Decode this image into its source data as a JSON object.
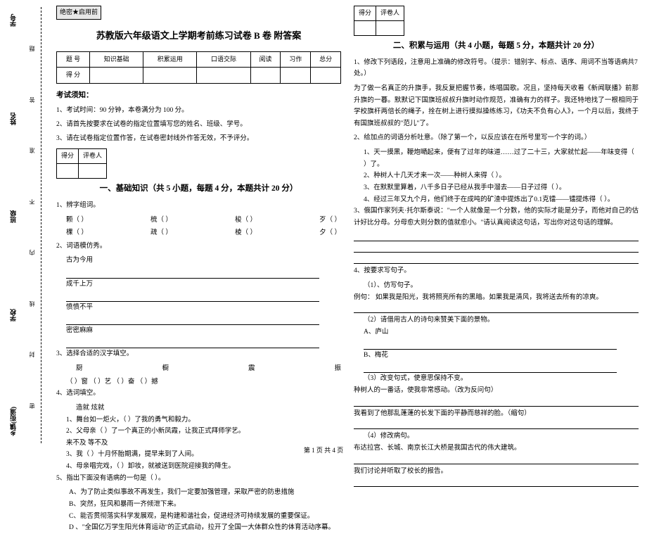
{
  "binding": {
    "labels": [
      "学号",
      "姓名",
      "班级",
      "学校",
      "乡镇(街道)"
    ],
    "marks": [
      "题",
      "答",
      "准",
      "不",
      "内",
      "线",
      "封",
      "密"
    ]
  },
  "header": {
    "secret": "绝密★启用前",
    "title": "苏教版六年级语文上学期考前练习试卷 B 卷 附答案"
  },
  "score_table": {
    "cols": [
      "题  号",
      "知识基础",
      "积累运用",
      "口语交际",
      "阅读",
      "习作",
      "总分"
    ],
    "row2": "得  分"
  },
  "notice": {
    "title": "考试须知：",
    "items": [
      "1、考试时间：90 分钟，本卷满分为 100 分。",
      "2、请首先按要求在试卷的指定位置填写您的姓名、班级、学号。",
      "3、请在试卷指定位置作答，在试卷密封线外作答无效，不予评分。"
    ]
  },
  "mini": {
    "c1": "得分",
    "c2": "评卷人"
  },
  "sec1": {
    "title": "一、基础知识（共 5 小题，每题 4 分，本题共计 20 分）",
    "q1": "1、辨字组词。",
    "q1_rows": [
      [
        "颗（        ）",
        "梳（        ）",
        "梭（        ）",
        "歹（        ）"
      ],
      [
        "棵（        ）",
        "疏（        ）",
        "棱（        ）",
        "夕（        ）"
      ]
    ],
    "q2": "2、词语模仿秀。",
    "q2_items": [
      "古为今用",
      "成千上万",
      "愤愤不平",
      "密密麻麻"
    ],
    "q3": "3、选择合适的汉字填空。",
    "q3_row1": [
      "厨",
      "橱",
      "震",
      "振"
    ],
    "q3_row2": "（    ）窗       （    ）艺       （    ）奋       （    ）撼",
    "q4": "4、选词填空。",
    "q4_words": "造就        炫就",
    "q4_items": [
      "1、舞台如一炬火，（     ）了我的勇气和毅力。",
      "2、父母亲（     ）了一个真正的小新凤霞，让我正式拜师学艺。",
      "             来不及     等不及",
      "3、我（     ）十月怀胎期满，提早来到了人间。",
      "4、母亲唱完戏，（     ）卸妆，就被送到医院迎接我的降生。"
    ],
    "q5": "5、指出下面没有语病的一句是（        ）。",
    "q5_opts": [
      "A、为了防止类似事故不再发生，我们一定要加强管理，采取严密的防患措施",
      "B、突然，狂风和暴雨一齐倾泄下来。",
      "C、能否贯彻落实科学发展观，是构建和谐社会，促进经济可持续发展的重要保证。",
      "D 、\"全国亿万学生阳光体育运动\"的正式启动，拉开了全国一大体群众性的体育活动序幕。"
    ]
  },
  "sec2": {
    "title": "二、积累与运用（共 4 小题，每题 5 分，本题共计 20 分）",
    "q1": "1、修改下列语段，注意用上准确的修改符号。（提示：错别字、标点、语序、用词不当等语病共7处。）",
    "q1_body": "    为了做一名真正的升旗手，我反复把握节奏，练唱国歌。况且，坚持每天收看《新闻联播》前那升旗的一暮。默默记下国旗班叔叔升旗时动作规范，准确有力的样子。我还特地找了一根相同于学校旗杆两倍长的绳子，拴在树上进行摸拟操练练习，《功夫不负有心人》，一个月以后，我终于有国旗班叔叔的\"范儿\"了。",
    "q2": "2、给加点的词语分析吐意。（除了第一个，以反应该在在所号里写一个字的词。）",
    "q2_items": [
      "1、天一摸黑，鞭炮嗮起来，便有了过年的味道……过了二十三，大家就忙起——年味变得（   ）了。",
      "2、种树人十几天才来一次——种树人来得（   ）。",
      "3、在默默里算着，八千多日子已经从我手中溜去——日子过得（   ）。",
      "4、经过三年又九个月，他们终于在成吨的矿渣中提炼出了0.1克镭——镭提炼得（   ）。"
    ],
    "q3": "3、俄国作家列夫·托尔斯泰说：\"一个人就像是一个分数，他的实际才能是分子，而他对自己的估计好比分母。分母愈大则分数的值就愈小。\"请认真阅读这句话，写出你对这句话的理解。",
    "q4": "4、按要求写句子。",
    "q4_1": "（1）、仿写句子。",
    "q4_1_ex": "    例句：   如果我是阳光，我将照亮所有的黑暗。如果我是清风，我将送去所有的凉爽。",
    "q4_2": "（2）请借用古人的诗句来赞美下面的景物。",
    "q4_2_items": [
      "A、庐山",
      "B、梅花"
    ],
    "q4_3": "（3）改变句式，使意思保持不变。",
    "q4_3_a": "    种树人的一番话，使我非常感动。（改为反问句）",
    "q4_3_b": "    我看到了他那乱蓬蓬的长发下面的平静而慈祥的脸。（缩句）",
    "q4_4": "（4）修改病句。",
    "q4_4_items": [
      "    布达拉宫、长城、南京长江大桥是我国古代的伟大建筑。",
      "    我们讨论并听取了校长的报告。"
    ]
  },
  "footer": "第 1 页 共 4 页"
}
